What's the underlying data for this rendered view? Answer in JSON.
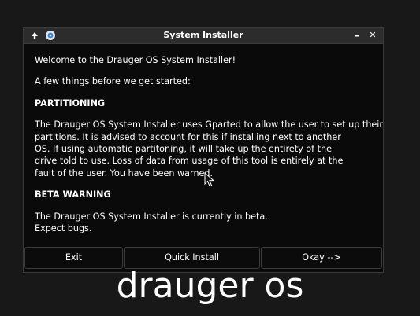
{
  "window": {
    "title": "System Installer",
    "controls": {
      "minimize": "–",
      "close": "✕"
    }
  },
  "content": {
    "welcome": "Welcome to the Drauger OS System Installer!",
    "intro": "A few things before we get started:",
    "partitioning": {
      "heading": "PARTITIONING",
      "lines": [
        "The Drauger OS System Installer uses Gparted to allow the user to set up their",
        "partitions. It is advised to account for this if installing next to another",
        "OS. If using automatic partitoning, it will take up the entirety of the",
        "drive told to use. Loss of data from usage of this tool is entirely at the",
        "fault of the user. You have been warned."
      ]
    },
    "beta": {
      "heading": "BETA WARNING",
      "lines": [
        "The Drauger OS System Installer is currently in beta.",
        "Expect bugs."
      ]
    }
  },
  "buttons": {
    "exit": "Exit",
    "quick_install": "Quick Install",
    "okay": "Okay -->"
  },
  "branding": "drauger os"
}
